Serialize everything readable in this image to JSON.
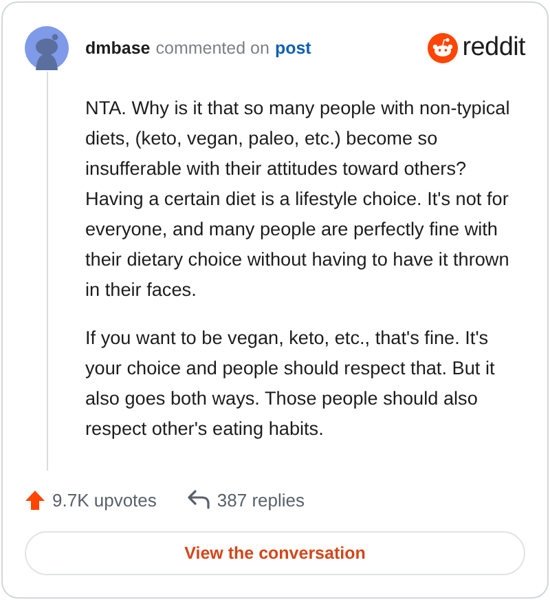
{
  "comment": {
    "author": "dmbase",
    "action": "commented on",
    "link": "post"
  },
  "brand": {
    "name": "reddit"
  },
  "body": [
    "NTA. Why is it that so many people with non-typical diets, (keto, vegan, paleo, etc.) become so insufferable with their attitudes toward others? Having a certain diet is a lifestyle choice. It's not for everyone, and many people are perfectly fine with their dietary choice without having to have it thrown in their faces.",
    "If you want to be vegan, keto, etc., that's fine. It's your choice and people should respect that. But it also goes both ways. Those people should also respect other's eating habits."
  ],
  "stats": {
    "upvotes": "9.7K upvotes",
    "replies": "387 replies"
  },
  "button": "View the conversation"
}
